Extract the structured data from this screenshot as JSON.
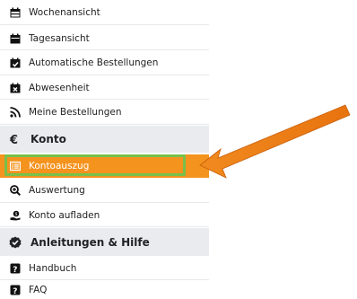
{
  "sidebar": {
    "items": [
      {
        "label": "Wochenansicht",
        "icon": "calendar-week-icon"
      },
      {
        "label": "Tagesansicht",
        "icon": "calendar-day-icon"
      },
      {
        "label": "Automatische Bestellungen",
        "icon": "calendar-check-icon"
      },
      {
        "label": "Abwesenheit",
        "icon": "calendar-times-icon"
      },
      {
        "label": "Meine Bestellungen",
        "icon": "rss-icon"
      }
    ],
    "konto_section": {
      "label": "Konto",
      "icon": "euro-icon"
    },
    "konto_items": [
      {
        "label": "Kontoauszug",
        "icon": "list-alt-icon",
        "active": true
      },
      {
        "label": "Auswertung",
        "icon": "search-plus-icon"
      },
      {
        "label": "Konto aufladen",
        "icon": "money-hand-icon"
      }
    ],
    "help_section": {
      "label": "Anleitungen & Hilfe",
      "icon": "badge-check-icon"
    },
    "help_items": [
      {
        "label": "Handbuch",
        "icon": "question-square-icon"
      },
      {
        "label": "FAQ",
        "icon": "question-square-icon"
      }
    ]
  },
  "colors": {
    "accent": "#f4931e",
    "highlight": "#77c04b",
    "section_bg": "#e9ebef",
    "arrow": "#f0821e"
  }
}
